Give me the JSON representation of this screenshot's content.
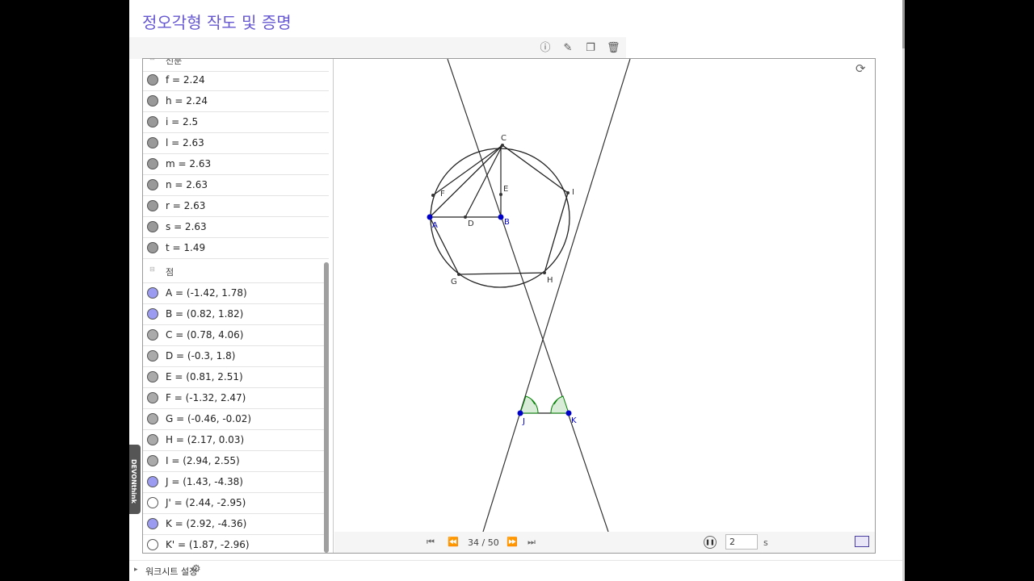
{
  "page_title": "정오각형 작도 및 증명",
  "toolbar": {
    "info_icon": "ⓘ",
    "edit_icon": "✎",
    "copy_icon": "❐",
    "delete_icon": "🗑"
  },
  "algebra": {
    "partial_header": "선분",
    "segments": [
      {
        "label": "f = 2.24"
      },
      {
        "label": "h = 2.24"
      },
      {
        "label": "i = 2.5"
      },
      {
        "label": "l = 2.63"
      },
      {
        "label": "m = 2.63"
      },
      {
        "label": "n = 2.63"
      },
      {
        "label": "r = 2.63"
      },
      {
        "label": "s = 2.63"
      },
      {
        "label": "t = 1.49"
      }
    ],
    "points_header": "점",
    "points": [
      {
        "label": "A = (-1.42, 1.78)"
      },
      {
        "label": "B = (0.82, 1.82)"
      },
      {
        "label": "C = (0.78, 4.06)"
      },
      {
        "label": "D = (-0.3, 1.8)"
      },
      {
        "label": "E = (0.81, 2.51)"
      },
      {
        "label": "F = (-1.32, 2.47)"
      },
      {
        "label": "G = (-0.46, -0.02)"
      },
      {
        "label": "H = (2.17, 0.03)"
      },
      {
        "label": "I = (2.94, 2.55)"
      },
      {
        "label": "J = (1.43, -4.38)"
      },
      {
        "label": "J' = (2.44, -2.95)"
      },
      {
        "label": "K = (2.92, -4.36)"
      },
      {
        "label": "K' = (1.87, -2.96)"
      }
    ]
  },
  "graphics": {
    "labels": {
      "A": "A",
      "B": "B",
      "C": "C",
      "D": "D",
      "E": "E",
      "F": "F",
      "G": "G",
      "H": "H",
      "I": "I",
      "J": "J",
      "K": "K"
    },
    "refresh_icon": "⟳"
  },
  "animation": {
    "first_icon": "⏮",
    "prev_icon": "⏪",
    "frame": "34 / 50",
    "next_icon": "⏩",
    "last_icon": "⏭",
    "pause_icon": "❚❚",
    "speed": "2",
    "speed_unit": "s"
  },
  "footer": {
    "chevron": "▸",
    "label": "워크시트 설정",
    "gear_icon": "⚙"
  },
  "devon_tab": "DEVONthink",
  "colors": {
    "title": "#6557d2",
    "free_point": "#9b9bf2",
    "dependent_point": "#aaaaaa",
    "segment_marble": "#999999",
    "angle_fill": "#d8ecd8",
    "angle_stroke": "#008000",
    "point_blue": "#0000cc"
  }
}
